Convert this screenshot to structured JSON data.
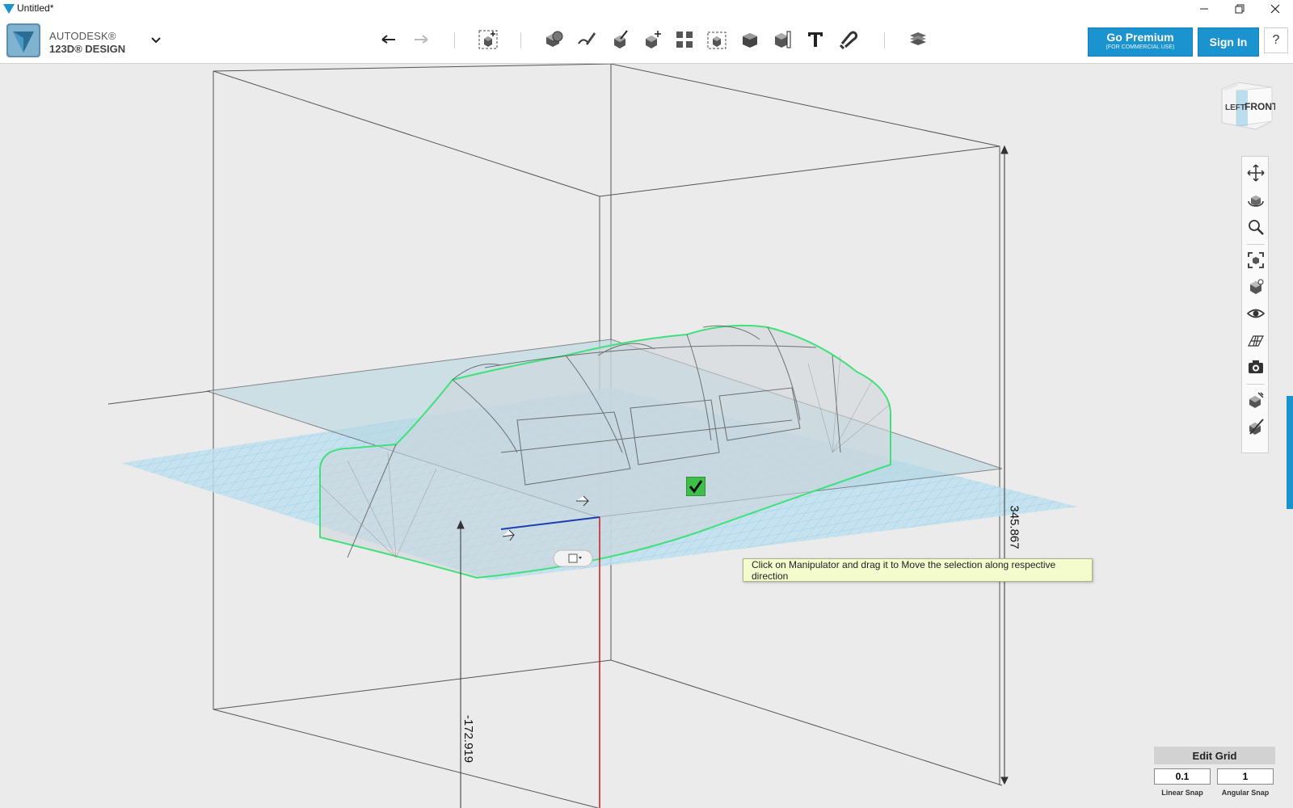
{
  "window": {
    "title": "Untitled*"
  },
  "brand": {
    "line1": "AUTODESK®",
    "line2": "123D® DESIGN"
  },
  "header": {
    "premium_label": "Go Premium",
    "premium_sub": "(FOR COMMERCIAL USE)",
    "signin_label": "Sign In",
    "help_label": "?"
  },
  "toolbar": {
    "tools": [
      "undo-icon",
      "redo-icon",
      "transform-icon",
      "primitives-icon",
      "sketch-icon",
      "construct-icon",
      "modify-icon",
      "pattern-icon",
      "group-icon",
      "combine-icon",
      "measure-icon",
      "text-icon",
      "snap-icon",
      "material-icon"
    ]
  },
  "viewcube": {
    "left_face": "LEFT",
    "front_face": "FRONT"
  },
  "navbar": {
    "items": [
      "pan-icon",
      "orbit-icon",
      "zoom-icon",
      "fit-icon",
      "view-icon",
      "visibility-icon",
      "grid-icon",
      "camera-icon",
      "snapshot-icon",
      "materials-icon"
    ]
  },
  "viewport": {
    "dimension_height": "345.867",
    "dimension_offset": "-172.919",
    "tooltip": "Click on Manipulator and drag it to Move the selection along respective direction"
  },
  "grid_panel": {
    "edit_label": "Edit Grid",
    "linear_value": "0.1",
    "angular_value": "1",
    "linear_label": "Linear Snap",
    "angular_label": "Angular Snap"
  }
}
